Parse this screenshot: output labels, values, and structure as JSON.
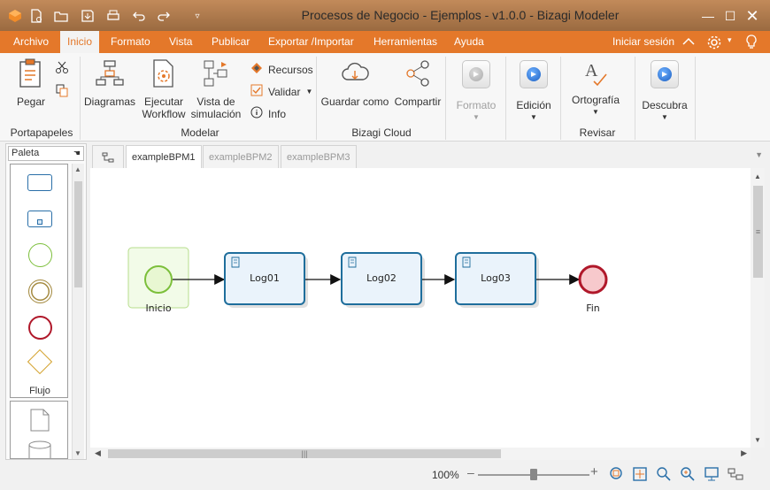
{
  "window": {
    "title": "Procesos de Negocio - Ejemplos - v1.0.0 - Bizagi Modeler"
  },
  "menu": {
    "tabs": [
      "Archivo",
      "Inicio",
      "Formato",
      "Vista",
      "Publicar",
      "Exportar /Importar",
      "Herramientas",
      "Ayuda"
    ],
    "active": "Inicio",
    "login": "Iniciar sesión"
  },
  "ribbon": {
    "paste": "Pegar",
    "clipboard_group": "Portapapeles",
    "diagrams": "Diagramas",
    "run_workflow": [
      "Ejecutar",
      "Workflow"
    ],
    "sim_view": [
      "Vista de",
      "simulación"
    ],
    "resources": "Recursos",
    "validate": "Validar",
    "info": "Info",
    "model_group": "Modelar",
    "save_as": "Guardar como",
    "share": "Compartir",
    "cloud_group": "Bizagi Cloud",
    "format": "Formato",
    "edit": "Edición",
    "spelling": "Ortografía",
    "review_group": "Revisar",
    "discover": "Descubra"
  },
  "palette": {
    "title": "Paleta",
    "flow_label": "Flujo"
  },
  "doc_tabs": [
    "exampleBPM1",
    "exampleBPM2",
    "exampleBPM3"
  ],
  "active_doc_tab": 0,
  "diagram": {
    "start_label": "Inicio",
    "tasks": [
      "Log01",
      "Log02",
      "Log03"
    ],
    "end_label": "Fin"
  },
  "status": {
    "zoom": "100%",
    "zoom_level": 0.5
  },
  "colors": {
    "accent": "#e4782a",
    "task_border": "#1f6e9c",
    "task_fill": "#eaf3fb",
    "start_fill": "#e8f7d2",
    "start_border": "#7cbf3b",
    "end_fill": "#f7c9cc",
    "end_border": "#b0182a"
  }
}
